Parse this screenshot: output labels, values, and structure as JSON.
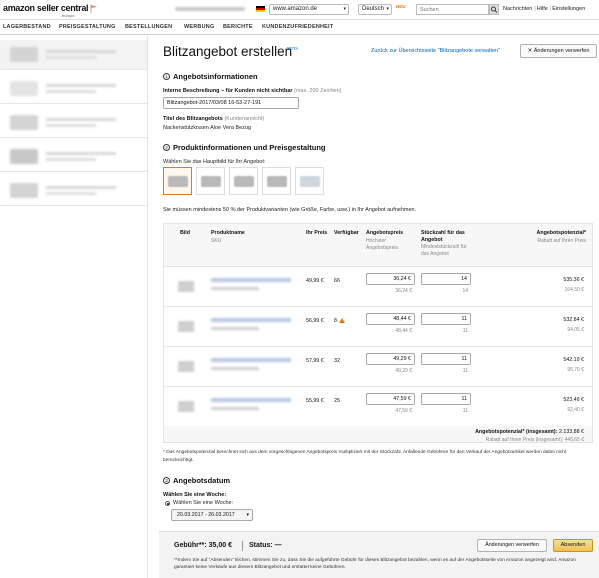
{
  "header": {
    "logo": "amazon seller central",
    "logo_sub": "europe",
    "marketplace": "www.amazon.de",
    "language": "Deutsch",
    "new_badge": "NEU",
    "search_placeholder": "Suchen",
    "links": [
      "Nachrichten",
      "Hilfe",
      "Einstellungen"
    ]
  },
  "nav": [
    "LAGERBESTAND",
    "PREISGESTALTUNG",
    "BESTELLUNGEN",
    "WERBUNG",
    "BERICHTE",
    "KUNDENZUFRIEDENHEIT"
  ],
  "page": {
    "title": "Blitzangebot erstellen",
    "beta": "BETA",
    "back_link": "Zurück zur Übersichtsseite \"Blitzangebote verwalten\"",
    "discard_label": "Änderungen verwerfen"
  },
  "section1": {
    "num": "1",
    "title": "Angebotsinformationen",
    "desc_label": "Interne Beschreibung – für Kunden nicht sichtbar",
    "desc_hint": "(max. 200 Zeichen)",
    "desc_value": "Blitzangebot-2017/03/08 16-53-27-191",
    "offer_title_label": "Titel des Blitzangebots",
    "offer_title_hint": "(Kundenansicht)",
    "offer_title_value": "Nackenstützkissen Aloe Vera Bezug"
  },
  "section2": {
    "num": "2",
    "title": "Produktinformationen und Preisgestaltung",
    "choose_image": "Wählen Sie das Hauptbild für Ihr Angebot:",
    "variant_note": "Sie müssen mindestens 50 % der Produktvarianten (wie Größe, Farbe, usw.) in Ihr Angebot aufnehmen.",
    "columns": {
      "image": "Bild",
      "product": "Produktname",
      "sku": "SKU",
      "your_price": "Ihr Preis",
      "available": "Verfügbar",
      "offer_price": "Angebotspreis",
      "offer_price_sub": "Höchster Angebotspreis",
      "qty": "Stückzahl für das Angebot",
      "qty_sub": "Mindeststückzahl für das Angebot",
      "potential": "Angebotspotenzial*",
      "potential_sub": "Rabatt auf Ihren Preis"
    },
    "rows": [
      {
        "price": "49,99 €",
        "available": "66",
        "warn": false,
        "offer": "36,24 €",
        "offer_max": "36,24 €",
        "qty": "14",
        "qty_min": "14",
        "potential": "535,36 €",
        "discount": "164,50 €"
      },
      {
        "price": "56,99 €",
        "available": "8",
        "warn": true,
        "offer": "48,44 €",
        "offer_max": "48,44 €",
        "qty": "11",
        "qty_min": "11",
        "potential": "532,84 €",
        "discount": "94,05 €"
      },
      {
        "price": "57,99 €",
        "available": "32",
        "warn": false,
        "offer": "49,29 €",
        "offer_max": "49,29 €",
        "qty": "11",
        "qty_min": "11",
        "potential": "542,19 €",
        "discount": "95,70 €"
      },
      {
        "price": "55,99 €",
        "available": "25",
        "warn": false,
        "offer": "47,59 €",
        "offer_max": "47,59 €",
        "qty": "11",
        "qty_min": "11",
        "potential": "523,49 €",
        "discount": "92,40 €"
      }
    ],
    "total_label": "Angebotspotenzial* (insgesamt):",
    "total_value": "2.133,88 €",
    "total_discount_label": "Rabatt auf Ihren Preis (insgesamt):",
    "total_discount_value": "446,65 €",
    "footnote": "* Das Angebotspotenzial berechnet sich aus dem vorgeschlagenen Angebotspreis multipliziert mit der Stückzahl. Anfallende Gebühren für den Verkauf der Angebotsartikel werden dabei nicht berücksichtigt."
  },
  "section3": {
    "num": "3",
    "title": "Angebotsdatum",
    "choose_week": "Wählen Sie eine Woche:",
    "radio_label": "Wählen Sie eine Woche:",
    "date_range": "20.03.2017 - 26.03.2017"
  },
  "footer": {
    "fee": "Gebühr**: 35,00 €",
    "status": "Status: —",
    "discard_label": "Änderungen verwerfen",
    "submit_label": "Absenden",
    "note": "**Indem Sie auf \"Absenden\" klicken, stimmen Sie zu, dass Sie die aufgeführte Gebühr für dieses Blitzangebot bezahlen, wenn es auf der Angebotsseite von Amazon angezeigt wird. Amazon garantiert keine Verkäufe aus diesem Blitzangebot und erstattet keine Gebühren."
  },
  "colors": {
    "accent": "#e47911",
    "link": "#0066c0",
    "submit": "#f0c14b"
  }
}
